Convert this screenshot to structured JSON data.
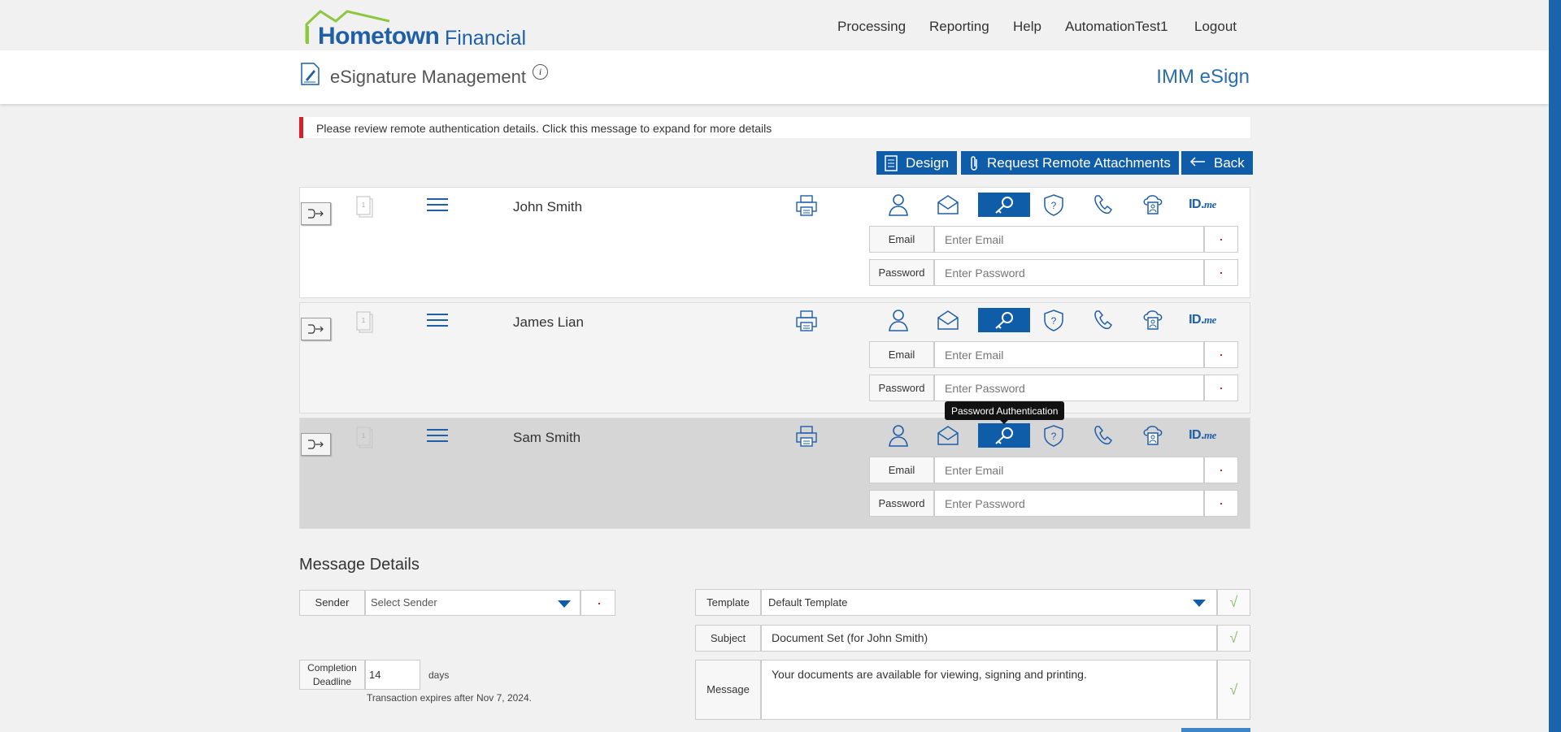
{
  "brand": {
    "name": "Hometown",
    "suffix": "Financial"
  },
  "nav": [
    "Processing",
    "Reporting",
    "Help",
    "AutomationTest1",
    "Logout"
  ],
  "page": {
    "title": "eSignature Management",
    "info_icon": "i",
    "app_name": "IMM eSign"
  },
  "alert": {
    "text": "Please review remote authentication details. Click this message to expand for more details"
  },
  "toolbar": {
    "design": "Design",
    "request": "Request Remote Attachments",
    "back": "Back"
  },
  "signers": [
    {
      "name": "John Smith",
      "doc_page": "1",
      "email_label": "Email",
      "email_placeholder": "Enter Email",
      "password_label": "Password",
      "password_placeholder": "Enter Password"
    },
    {
      "name": "James Lian",
      "doc_page": "1",
      "email_label": "Email",
      "email_placeholder": "Enter Email",
      "password_label": "Password",
      "password_placeholder": "Enter Password"
    },
    {
      "name": "Sam Smith",
      "doc_page": "1",
      "email_label": "Email",
      "email_placeholder": "Enter Email",
      "password_label": "Password",
      "password_placeholder": "Enter Password"
    }
  ],
  "auth_methods": [
    "person-icon",
    "email-icon",
    "password-key-icon",
    "shield-question-icon",
    "phone-icon",
    "cloud-id-icon",
    "idme-logo"
  ],
  "idme": {
    "id": "ID.",
    "me": "me"
  },
  "tooltip": "Password Authentication",
  "message_details": {
    "title": "Message Details",
    "sender_label": "Sender",
    "sender_value": "Select Sender",
    "deadline_label_1": "Completion",
    "deadline_label_2": "Deadline",
    "deadline_value": "14",
    "deadline_unit": "days",
    "expires": "Transaction expires after Nov 7, 2024.",
    "template_label": "Template",
    "template_value": "Default Template",
    "subject_label": "Subject",
    "subject_value": "Document Set (for John Smith)",
    "message_label": "Message",
    "message_value": "Your documents are available for viewing, signing and printing.",
    "check": "√"
  },
  "colors": {
    "primary": "#0f5da8",
    "alert": "#d9202a",
    "selected_row": "#d6d6d6",
    "check": "#8cbf6b"
  }
}
